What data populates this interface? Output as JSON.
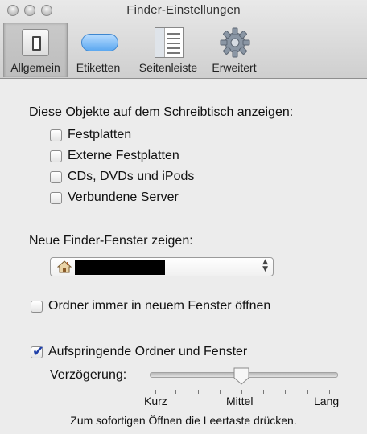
{
  "window": {
    "title": "Finder-Einstellungen"
  },
  "toolbar": {
    "tabs": [
      {
        "label": "Allgemein",
        "selected": true
      },
      {
        "label": "Etiketten",
        "selected": false
      },
      {
        "label": "Seitenleiste",
        "selected": false
      },
      {
        "label": "Erweitert",
        "selected": false
      }
    ]
  },
  "desktop": {
    "heading": "Diese Objekte auf dem Schreibtisch anzeigen:",
    "items": [
      {
        "label": "Festplatten",
        "checked": false
      },
      {
        "label": "Externe Festplatten",
        "checked": false
      },
      {
        "label": "CDs, DVDs und iPods",
        "checked": false
      },
      {
        "label": "Verbundene Server",
        "checked": false
      }
    ]
  },
  "new_window": {
    "heading": "Neue Finder-Fenster zeigen:",
    "selected_value": "",
    "icon": "home-icon"
  },
  "open_folders": {
    "label": "Ordner immer in neuem Fenster öffnen",
    "checked": false
  },
  "spring_loaded": {
    "label": "Aufspringende Ordner und Fenster",
    "checked": true
  },
  "delay": {
    "label": "Verzögerung:",
    "ticks": [
      "Kurz",
      "Mittel",
      "Lang"
    ],
    "selected": "Mittel"
  },
  "hint": "Zum sofortigen Öffnen die Leertaste drücken.",
  "colors": {
    "check_accent": "#1f3fa8",
    "toolbar_selected": "#c4c4c4"
  }
}
